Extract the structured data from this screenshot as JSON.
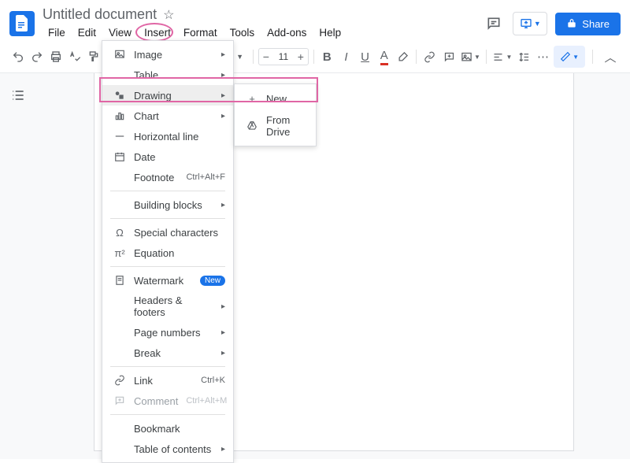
{
  "header": {
    "doc_title": "Untitled document",
    "share_label": "Share"
  },
  "menubar": {
    "file": "File",
    "edit": "Edit",
    "view": "View",
    "insert": "Insert",
    "format": "Format",
    "tools": "Tools",
    "addons": "Add-ons",
    "help": "Help"
  },
  "toolbar": {
    "font_size": "11"
  },
  "insert_menu": {
    "image": "Image",
    "table": "Table",
    "drawing": "Drawing",
    "chart": "Chart",
    "hr": "Horizontal line",
    "date": "Date",
    "footnote": "Footnote",
    "footnote_sc": "Ctrl+Alt+F",
    "building_blocks": "Building blocks",
    "special_chars": "Special characters",
    "equation": "Equation",
    "watermark": "Watermark",
    "watermark_badge": "New",
    "headers_footers": "Headers & footers",
    "page_numbers": "Page numbers",
    "break": "Break",
    "link": "Link",
    "link_sc": "Ctrl+K",
    "comment": "Comment",
    "comment_sc": "Ctrl+Alt+M",
    "bookmark": "Bookmark",
    "toc": "Table of contents"
  },
  "drawing_submenu": {
    "new": "New",
    "from_drive": "From Drive"
  }
}
